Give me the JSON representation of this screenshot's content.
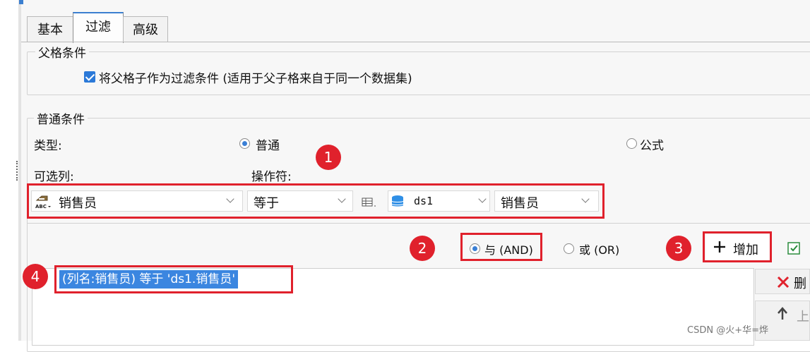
{
  "tabs": [
    {
      "label": "基本"
    },
    {
      "label": "过滤"
    },
    {
      "label": "高级"
    }
  ],
  "parent_section": {
    "title": "父格条件",
    "checkbox_label": "将父格子作为过滤条件 (适用于父子格来自于同一个数据集)",
    "checked": true
  },
  "normal_section": {
    "title": "普通条件",
    "type_label": "类型:",
    "type_normal": "普通",
    "type_formula": "公式",
    "column_label": "可选列:",
    "operator_label": "操作符:",
    "column_value": "销售员",
    "operator_value": "等于",
    "dataset_value": "ds1",
    "field_value": "销售员"
  },
  "logic": {
    "and_label": "与 (AND)",
    "or_label": "或 (OR)",
    "add_label": "增加"
  },
  "condition_item": "(列名:销售员) 等于 'ds1.销售员'",
  "side_buttons": {
    "delete_label": "删",
    "up_label": "上"
  },
  "badges": [
    "1",
    "2",
    "3",
    "4"
  ],
  "watermark": "CSDN @火+华=烨",
  "colors": {
    "accent": "#2b79d8",
    "highlight_red": "#e0212c",
    "selection_bg": "#3b86e0"
  }
}
